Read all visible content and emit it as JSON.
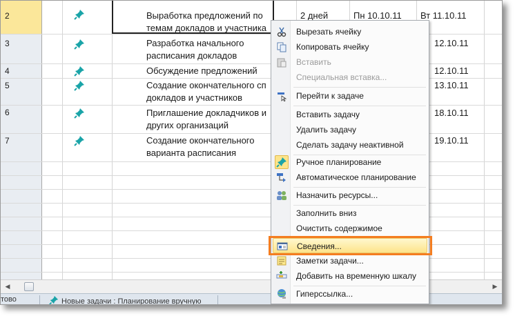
{
  "tasks": [
    {
      "num": "2",
      "name1": "Выработка предложений по",
      "name2": "темам докладов и участника",
      "dur": "2 дней",
      "start": "Пн 10.10.11",
      "finish": "Вт 11.10.11",
      "selected": true
    },
    {
      "num": "3",
      "name1": "Разработка начального",
      "name2": "расписания докладов",
      "finish_tail": "12.10.11"
    },
    {
      "num": "4",
      "name1": "Обсуждение предложений",
      "name2": "",
      "finish_tail": "12.10.11"
    },
    {
      "num": "5",
      "name1": "Создание окончательного сп",
      "name2": "докладов и участников",
      "finish_tail": "13.10.11"
    },
    {
      "num": "6",
      "name1": "Приглашение докладчиков и",
      "name2": "других организаций",
      "finish_tail": "18.10.11"
    },
    {
      "num": "7",
      "name1": "Создание окончательного",
      "name2": "варианта расписания",
      "finish_tail": "19.10.11"
    }
  ],
  "status": {
    "ready": "тово",
    "mode": "Новые задачи : Планирование вручную"
  },
  "menu": {
    "cut": "Вырезать ячейку",
    "copy": "Копировать ячейку",
    "paste": "Вставить",
    "paste_special": "Специальная вставка...",
    "goto": "Перейти к задаче",
    "insert_task": "Вставить задачу",
    "delete_task": "Удалить задачу",
    "inactive": "Сделать задачу неактивной",
    "manual": "Ручное планирование",
    "auto": "Автоматическое планирование",
    "assign": "Назначить ресурсы...",
    "fill_down": "Заполнить вниз",
    "clear": "Очистить содержимое",
    "info": "Сведения...",
    "notes": "Заметки задачи...",
    "timeline": "Добавить на временную шкалу",
    "hyperlink": "Гиперссылка..."
  },
  "colors": {
    "highlight_border": "#f47d20",
    "selected_row": "#fbe79a",
    "pin": "#1aa4a8"
  }
}
